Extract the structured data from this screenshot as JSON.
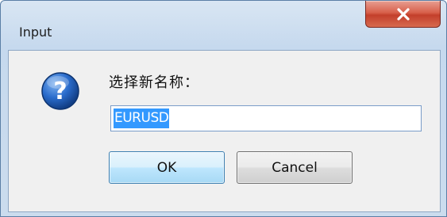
{
  "window": {
    "title": "Input",
    "close_icon": "close-icon"
  },
  "dialog": {
    "icon": "question-icon",
    "prompt": "选择新名称：",
    "input_value": "EURUSD",
    "input_selected": true
  },
  "buttons": {
    "ok_label": "OK",
    "cancel_label": "Cancel"
  },
  "colors": {
    "selection": "#3399ff",
    "close_button": "#c33f2b",
    "icon_blue": "#1f5fb8"
  }
}
